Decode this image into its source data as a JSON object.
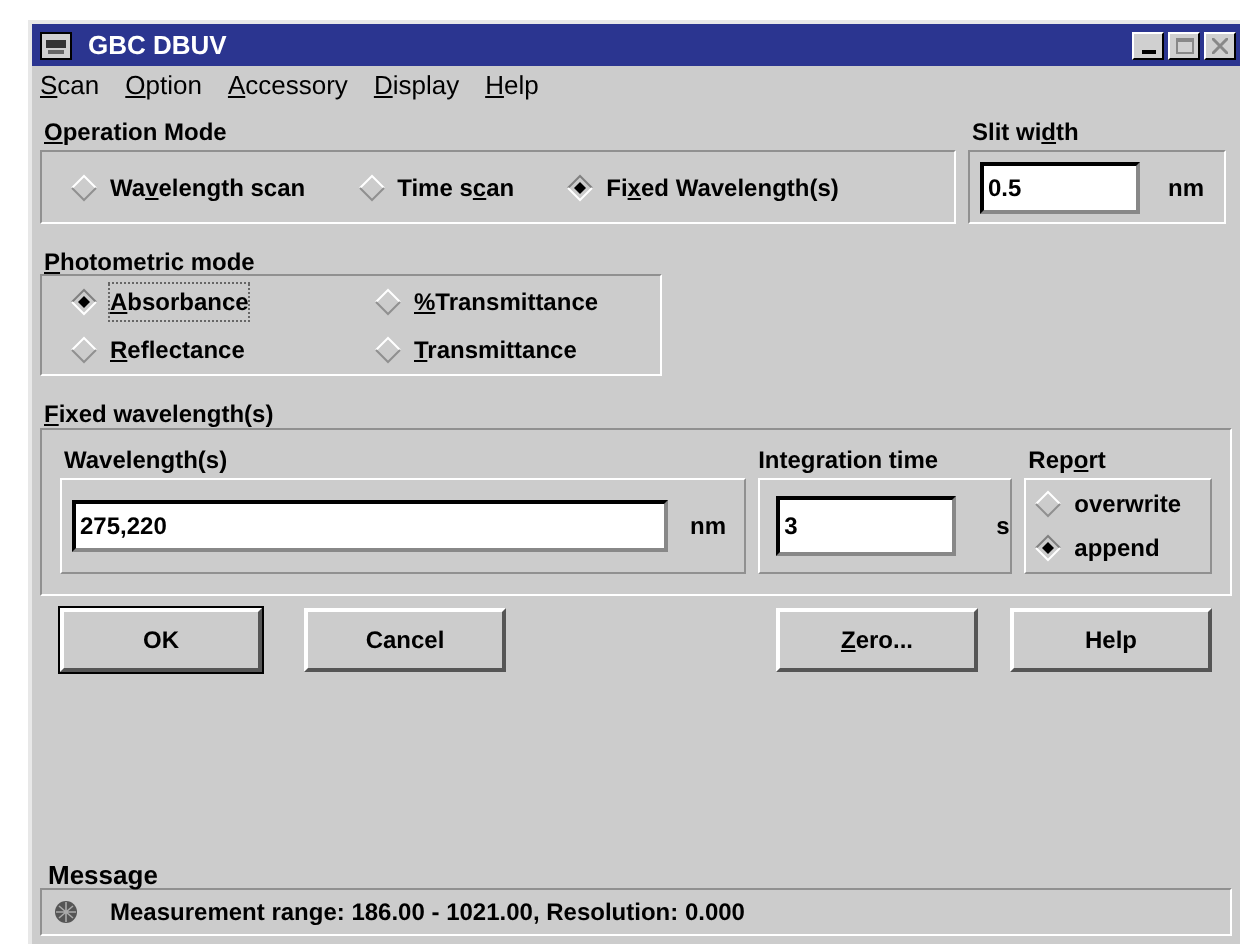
{
  "window": {
    "title": "GBC DBUV"
  },
  "menu": [
    {
      "label_parts": {
        "key": "S",
        "post": "can"
      }
    },
    {
      "label_parts": {
        "key": "O",
        "post": "ption"
      }
    },
    {
      "label_parts": {
        "key": "A",
        "post": "ccessory"
      }
    },
    {
      "label_parts": {
        "key": "D",
        "post": "isplay"
      }
    },
    {
      "label_parts": {
        "key": "H",
        "post": "elp"
      }
    }
  ],
  "operation_mode": {
    "heading_parts": {
      "key": "O",
      "post": "peration Mode"
    },
    "options": [
      {
        "label_parts": {
          "pre": "Wa",
          "key": "v",
          "post": "elength scan"
        },
        "selected": false
      },
      {
        "label_parts": {
          "pre": "Time s",
          "key": "c",
          "post": "an"
        },
        "selected": false
      },
      {
        "label_parts": {
          "pre": "Fi",
          "key": "x",
          "post": "ed Wavelength(s)"
        },
        "selected": true
      }
    ]
  },
  "slit_width": {
    "heading_parts": {
      "pre": "Slit wi",
      "key": "d",
      "post": "th"
    },
    "value": "0.5",
    "unit": "nm"
  },
  "photometric_mode": {
    "heading_parts": {
      "key": "P",
      "post": "hotometric mode"
    },
    "options": [
      {
        "label_parts": {
          "key": "A",
          "post": "bsorbance"
        },
        "selected": true
      },
      {
        "label_parts": {
          "key": "%",
          "post": "Transmittance"
        },
        "selected": false
      },
      {
        "label_parts": {
          "key": "R",
          "post": "eflectance"
        },
        "selected": false
      },
      {
        "label_parts": {
          "key": "T",
          "post": "ransmittance"
        },
        "selected": false
      }
    ]
  },
  "fixed_wavelength": {
    "heading_parts": {
      "key": "F",
      "post": "ixed wavelength(s)"
    },
    "wavelengths": {
      "label": "Wavelength(s)",
      "value": "275,220",
      "unit": "nm"
    },
    "integration_time": {
      "label": "Integration time",
      "value": "3",
      "unit": "s"
    },
    "report": {
      "heading_parts": {
        "pre": "Rep",
        "key": "o",
        "post": "rt"
      },
      "options": [
        {
          "label": "overwrite",
          "selected": false
        },
        {
          "label": "append",
          "selected": true
        }
      ]
    }
  },
  "buttons": [
    {
      "label_parts": {
        "post": "OK"
      },
      "default": true
    },
    {
      "label_parts": {
        "post": "Cancel"
      },
      "default": false
    },
    {
      "label_parts": {
        "key": "Z",
        "post": "ero..."
      },
      "default": false
    },
    {
      "label_parts": {
        "post": "Help"
      },
      "default": false
    }
  ],
  "message": {
    "heading": "Message",
    "text": "Measurement range: 186.00 - 1021.00, Resolution: 0.000"
  }
}
